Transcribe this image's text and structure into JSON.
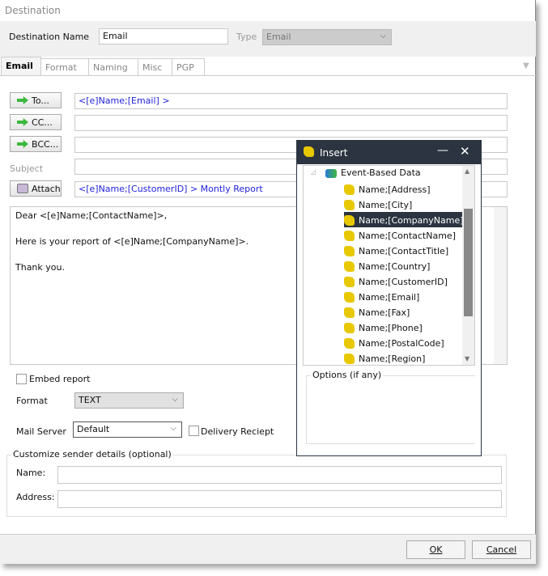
{
  "window": {
    "title": "Destination"
  },
  "header": {
    "name_label": "Destination Name",
    "name_value": "Email",
    "type_label": "Type",
    "type_value": "Email"
  },
  "tabs": [
    {
      "label": "Email"
    },
    {
      "label": "Format"
    },
    {
      "label": "Naming"
    },
    {
      "label": "Misc"
    },
    {
      "label": "PGP"
    }
  ],
  "email": {
    "to_button": "To...",
    "to_value": "<[e]Name;[Email] >",
    "cc_button": "CC...",
    "cc_value": "",
    "bcc_button": "BCC...",
    "bcc_value": "",
    "subject_label": "Subject",
    "subject_value": "",
    "attach_button": "Attach",
    "attach_value": "<[e]Name;[CustomerID] > Montly Report",
    "body_lines": [
      "Dear <[e]Name;[ContactName]>,",
      "Here is your report of <[e]Name;[CompanyName]>.",
      "Thank you."
    ],
    "embed_label": "Embed report",
    "embed_checked": false,
    "format_label": "Format",
    "format_value": "TEXT",
    "mail_server_label": "Mail Server",
    "mail_server_value": "Default",
    "delivery_label": "Delivery Reciept",
    "delivery_checked": false,
    "sender_group": "Customize sender details (optional)",
    "sender_name_label": "Name:",
    "sender_address_label": "Address:"
  },
  "insert": {
    "title": "Insert",
    "root": "Event-Based Data",
    "items": [
      "Name;[Address]",
      "Name;[City]",
      "Name;[CompanyName]",
      "Name;[ContactName]",
      "Name;[ContactTitle]",
      "Name;[Country]",
      "Name;[CustomerID]",
      "Name;[Email]",
      "Name;[Fax]",
      "Name;[Phone]",
      "Name;[PostalCode]",
      "Name;[Region]"
    ],
    "selected": "Name;[CompanyName]",
    "options_label": "Options (if any)"
  },
  "footer": {
    "ok": "OK",
    "cancel": "Cancel"
  },
  "colors": {
    "accent": "#2b3440",
    "field_text": "#2222dd"
  }
}
